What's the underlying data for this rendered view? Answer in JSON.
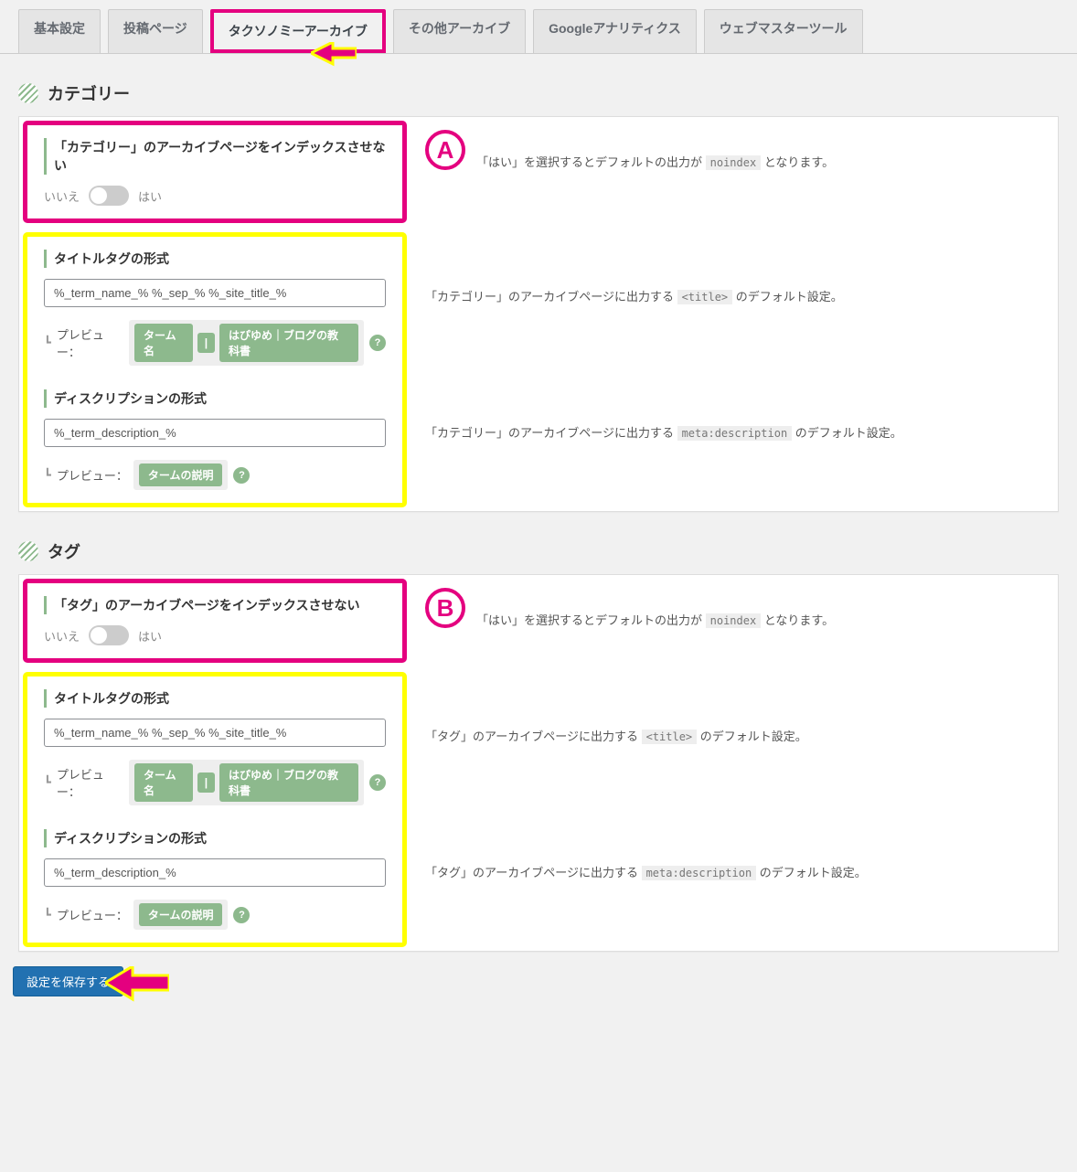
{
  "tabs": {
    "basic": "基本設定",
    "post": "投稿ページ",
    "taxonomy": "タクソノミーアーカイブ",
    "other": "その他アーカイブ",
    "analytics": "Googleアナリティクス",
    "webmaster": "ウェブマスターツール"
  },
  "badges": {
    "a": "A",
    "b": "B"
  },
  "category": {
    "header": "カテゴリー",
    "noindex": {
      "title": "「カテゴリー」のアーカイブページをインデックスさせない",
      "no_label": "いいえ",
      "yes_label": "はい",
      "desc_prefix": "「はい」を選択するとデフォルトの出力が ",
      "desc_code": "noindex",
      "desc_suffix": " となります。"
    },
    "title_format": {
      "title": "タイトルタグの形式",
      "value": "%_term_name_% %_sep_% %_site_title_%",
      "desc_prefix": "「カテゴリー」のアーカイブページに出力する ",
      "desc_code": "<title>",
      "desc_suffix": " のデフォルト設定。",
      "preview_label": "プレビュー：",
      "chip1": "ターム名",
      "chip_sep": "|",
      "chip2": "はぴゆめ｜ブログの教科書",
      "help": "?"
    },
    "desc_format": {
      "title": "ディスクリプションの形式",
      "value": "%_term_description_%",
      "desc_prefix": "「カテゴリー」のアーカイブページに出力する ",
      "desc_code": "meta:description",
      "desc_suffix": " のデフォルト設定。",
      "preview_label": "プレビュー：",
      "chip1": "タームの説明",
      "help": "?"
    }
  },
  "tag": {
    "header": "タグ",
    "noindex": {
      "title": "「タグ」のアーカイブページをインデックスさせない",
      "no_label": "いいえ",
      "yes_label": "はい",
      "desc_prefix": "「はい」を選択するとデフォルトの出力が ",
      "desc_code": "noindex",
      "desc_suffix": " となります。"
    },
    "title_format": {
      "title": "タイトルタグの形式",
      "value": "%_term_name_% %_sep_% %_site_title_%",
      "desc_prefix": "「タグ」のアーカイブページに出力する ",
      "desc_code": "<title>",
      "desc_suffix": " のデフォルト設定。",
      "preview_label": "プレビュー：",
      "chip1": "ターム名",
      "chip_sep": "|",
      "chip2": "はぴゆめ｜ブログの教科書",
      "help": "?"
    },
    "desc_format": {
      "title": "ディスクリプションの形式",
      "value": "%_term_description_%",
      "desc_prefix": "「タグ」のアーカイブページに出力する ",
      "desc_code": "meta:description",
      "desc_suffix": " のデフォルト設定。",
      "preview_label": "プレビュー：",
      "chip1": "タームの説明",
      "help": "?"
    }
  },
  "tree_prefix": "┗ ",
  "save_button": "設定を保存する"
}
